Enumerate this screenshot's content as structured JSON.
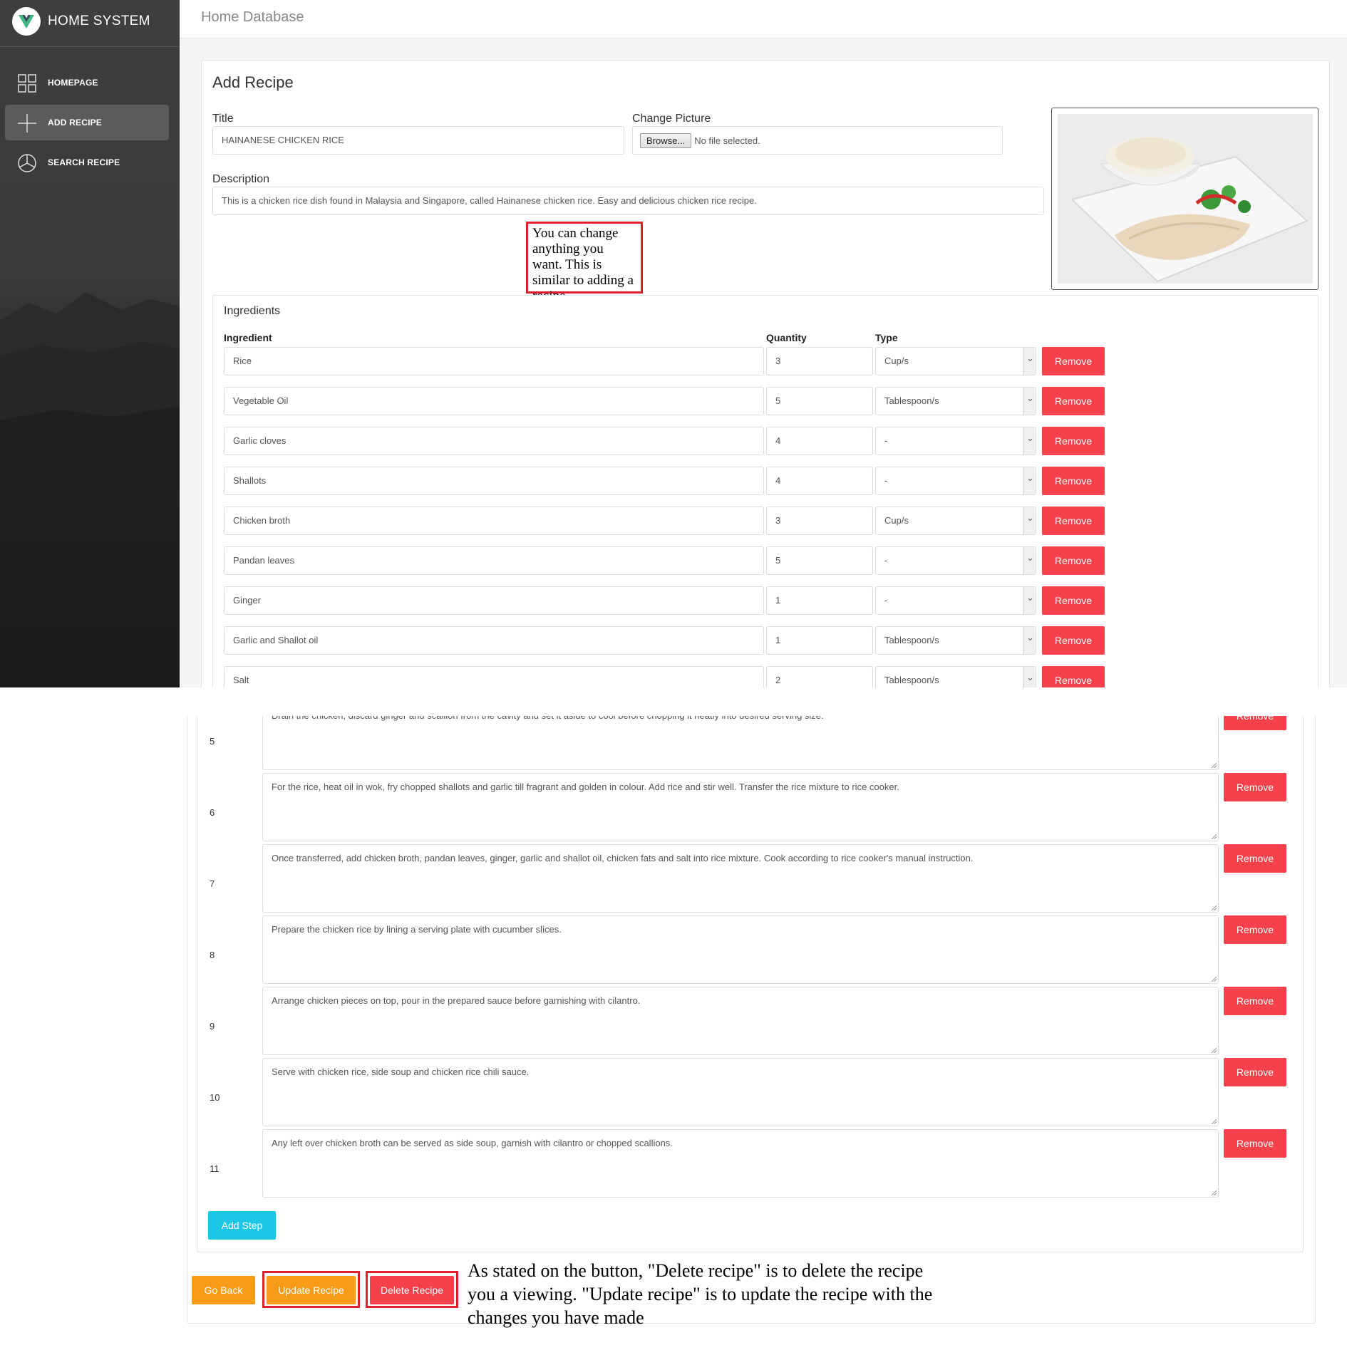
{
  "app": {
    "brand": "HOME SYSTEM",
    "header_title": "Home Database"
  },
  "sidebar": {
    "items": [
      {
        "label": "HOMEPAGE",
        "icon": "grid-icon",
        "active": false
      },
      {
        "label": "ADD RECIPE",
        "icon": "plus-icon",
        "active": true
      },
      {
        "label": "SEARCH RECIPE",
        "icon": "pie-chart-icon",
        "active": false
      }
    ]
  },
  "form": {
    "heading": "Add Recipe",
    "title_label": "Title",
    "title_value": "HAINANESE CHICKEN RICE",
    "picture_label": "Change Picture",
    "browse_label": "Browse...",
    "no_file_text": "No file selected.",
    "description_label": "Description",
    "description_value": "This is a chicken rice dish found in Malaysia and Singapore, called Hainanese chicken rice. Easy and delicious chicken rice recipe."
  },
  "annotations": {
    "top_note": "You can change anything you want. This is similar to adding a recipe",
    "bottom_note": "As stated on the button, \"Delete recipe\" is to delete the recipe you a viewing. \"Update recipe\" is to update the recipe with the changes you have made"
  },
  "ingredients": {
    "title": "Ingredients",
    "headers": {
      "ingredient": "Ingredient",
      "quantity": "Quantity",
      "type": "Type"
    },
    "remove_label": "Remove",
    "rows": [
      {
        "name": "Rice",
        "qty": "3",
        "type": "Cup/s"
      },
      {
        "name": "Vegetable Oil",
        "qty": "5",
        "type": "Tablespoon/s"
      },
      {
        "name": "Garlic cloves",
        "qty": "4",
        "type": "-"
      },
      {
        "name": "Shallots",
        "qty": "4",
        "type": "-"
      },
      {
        "name": "Chicken broth",
        "qty": "3",
        "type": "Cup/s"
      },
      {
        "name": "Pandan leaves",
        "qty": "5",
        "type": "-"
      },
      {
        "name": "Ginger",
        "qty": "1",
        "type": "-"
      },
      {
        "name": "Garlic and Shallot oil",
        "qty": "1",
        "type": "Tablespoon/s"
      },
      {
        "name": "Salt",
        "qty": "2",
        "type": "Tablespoon/s"
      }
    ]
  },
  "steps": {
    "remove_label": "Remove",
    "rows": [
      {
        "num": "5",
        "text": "Drain the chicken, discard ginger and scallion from the cavity and set it aside to cool before chopping it neatly into desired serving size."
      },
      {
        "num": "6",
        "text": "For the rice, heat oil in wok, fry chopped shallots and garlic till fragrant and golden in colour. Add rice and stir well. Transfer the rice mixture to rice cooker."
      },
      {
        "num": "7",
        "text": "Once transferred, add chicken broth, pandan leaves, ginger, garlic and shallot oil, chicken fats and salt into rice mixture. Cook according to rice cooker's manual instruction."
      },
      {
        "num": "8",
        "text": "Prepare the chicken rice by lining a serving plate with cucumber slices."
      },
      {
        "num": "9",
        "text": "Arrange chicken pieces on top, pour in the prepared sauce before garnishing with cilantro."
      },
      {
        "num": "10",
        "text": "Serve with chicken rice, side soup and chicken rice chili sauce."
      },
      {
        "num": "11",
        "text": "Any left over chicken broth can be served as side soup, garnish with cilantro or chopped scallions."
      }
    ],
    "add_label": "Add Step"
  },
  "actions": {
    "back": "Go Back",
    "update": "Update Recipe",
    "delete": "Delete Recipe"
  },
  "colors": {
    "danger": "#f4414b",
    "warning": "#f79c18",
    "info": "#1ec6e6",
    "highlight": "#e0202c",
    "sidebar": "#2e2e2e"
  }
}
